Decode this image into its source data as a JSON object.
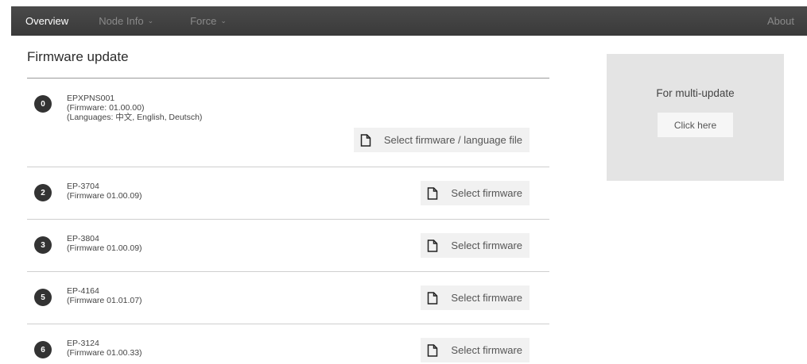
{
  "nav": {
    "items": [
      {
        "label": "Overview",
        "active": true
      },
      {
        "label": "Node Info",
        "dropdown": true
      },
      {
        "label": "Force",
        "dropdown": true
      }
    ],
    "about": "About"
  },
  "page": {
    "title": "Firmware update"
  },
  "devices": [
    {
      "num": "0",
      "name": "EPXPNS001",
      "firmware": "(Firmware: 01.00.00)",
      "languages": "(Languages: 中文, English, Deutsch)",
      "button": "Select firmware / language file"
    },
    {
      "num": "2",
      "name": "EP-3704",
      "firmware": "(Firmware 01.00.09)",
      "button": "Select firmware"
    },
    {
      "num": "3",
      "name": "EP-3804",
      "firmware": "(Firmware 01.00.09)",
      "button": "Select firmware"
    },
    {
      "num": "5",
      "name": "EP-4164",
      "firmware": "(Firmware 01.01.07)",
      "button": "Select firmware"
    },
    {
      "num": "6",
      "name": "EP-3124",
      "firmware": "(Firmware 01.00.33)",
      "button": "Select firmware"
    }
  ],
  "multi": {
    "title": "For multi-update",
    "button": "Click here"
  },
  "colors": {
    "nav_bg": "#404040",
    "badge": "#333333",
    "panel": "#e4e4e4"
  }
}
